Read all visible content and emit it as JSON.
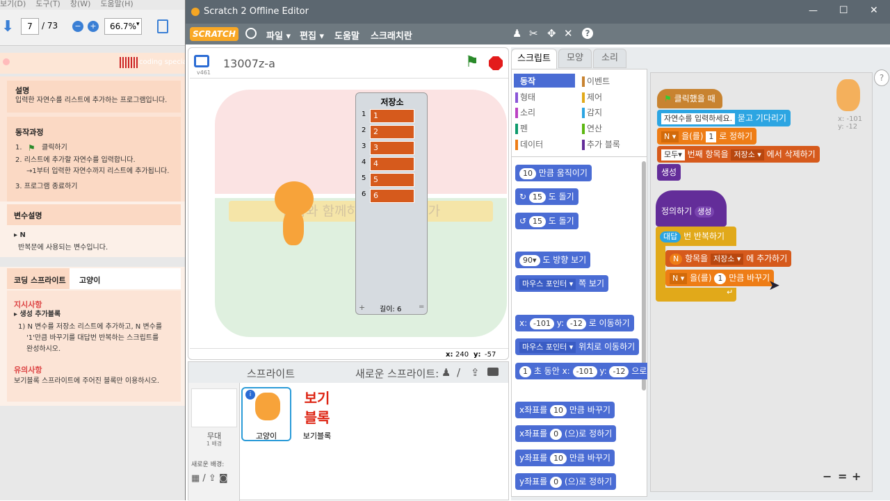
{
  "pdf": {
    "menus": [
      "보기(D)",
      "도구(T)",
      "창(W)",
      "도움말(H)"
    ],
    "page_current": "7",
    "page_total": "/ 73",
    "zoom": "66.7%",
    "sections": {
      "desc_title": "설명",
      "desc_text": "입력한 자연수를 리스트에 추가하는 프로그램입니다.",
      "proc_title": "동작과정",
      "proc_1a": "1.",
      "proc_1b": "클릭하기",
      "proc_2": "2.  리스트에 추가할 자연수를 입력합니다.",
      "proc_2b": "→1부터 입력한 자연수까지 리스트에 추가됩니다.",
      "proc_3": "3.  프로그램 종료하기",
      "var_title": "변수설명",
      "var_name": "▸ N",
      "var_text": "반복문에 사용되는 변수입니다.",
      "tab_a": "코딩 스프라이트",
      "tab_b": "고양이",
      "inst_title": "지시사항",
      "inst_sub": "▸ 생성 추가블록",
      "inst_text1": "1) N 변수를 저장소 리스트에 추가하고, N 변수를",
      "inst_text2": "'1'만큼 바꾸기를 대답번 반복하는 스크립트를",
      "inst_text3": "완성하시오.",
      "note_title": "유의사항",
      "note_text": "보기블록 스프라이트에 주어진 블록만 이용하시오.",
      "logo_text": "coding special"
    }
  },
  "window": {
    "title": "Scratch 2 Offline Editor",
    "min": "—",
    "max": "☐",
    "close": "✕"
  },
  "menubar": {
    "logo": "SCRATCH",
    "items": [
      "파일 ▾",
      "편집 ▾",
      "도움말",
      "스크래치란"
    ]
  },
  "stage": {
    "project": "13007z-a",
    "version": "v461",
    "coords_x_label": "x:",
    "coords_x": "240",
    "coords_y_label": "y:",
    "coords_y": "-57",
    "list": {
      "title": "저장소",
      "items": [
        "1",
        "2",
        "3",
        "4",
        "5",
        "6"
      ],
      "length": "길이: 6",
      "plus": "+",
      "resize": "="
    },
    "watermark": "엄마와 함께하는 코딩 전문가"
  },
  "sprites": {
    "header": "스프라이트",
    "new_label": "새로운 스프라이트:",
    "stage_name": "무대",
    "stage_count": "1 배경",
    "new_bg": "새로운 배경:",
    "cat_name": "고양이",
    "view_name": "보기블록",
    "view_text1": "보기",
    "view_text2": "블록"
  },
  "tabs": [
    "스크립트",
    "모양",
    "소리"
  ],
  "categories": {
    "left": [
      "동작",
      "형태",
      "소리",
      "펜",
      "데이터"
    ],
    "right": [
      "이벤트",
      "제어",
      "감지",
      "연산",
      "추가 블록"
    ]
  },
  "palette": {
    "move": [
      "10",
      "만큼 움직이기"
    ],
    "turn_r": [
      "15",
      "도 돌기"
    ],
    "turn_l": [
      "15",
      "도 돌기"
    ],
    "point": [
      "90▾",
      "도 방향 보기"
    ],
    "pointto": [
      "마우스 포인터 ▾",
      "쪽 보기"
    ],
    "goto": [
      "x:",
      "-101",
      "y:",
      "-12",
      "로 이동하기"
    ],
    "gotoobj": [
      "마우스 포인터 ▾",
      "위치로 이동하기"
    ],
    "glide": [
      "1",
      "초 동안 x:",
      "-101",
      "y:",
      "-12",
      "으로"
    ],
    "chx": [
      "x좌표를",
      "10",
      "만큼 바꾸기"
    ],
    "setx": [
      "x좌표를",
      "0",
      "(으)로 정하기"
    ],
    "chy": [
      "y좌표를",
      "10",
      "만큼 바꾸기"
    ],
    "sety": [
      "y좌표를",
      "0",
      "(으)로 정하기"
    ]
  },
  "script": {
    "hat": "클릭했을 때",
    "ask": [
      "자연수를 입력하세요.",
      "묻고 기다리기"
    ],
    "setn": [
      "N ▾",
      "을(를)",
      "1",
      "로 정하기"
    ],
    "del": [
      "모두▾",
      "번째 항목을",
      "저장소 ▾",
      "에서 삭제하기"
    ],
    "gen": "생성",
    "define": "정의하기",
    "define_arg": "생성",
    "repeat": [
      "대답",
      "번 반복하기"
    ],
    "add": [
      "N",
      "항목을",
      "저장소 ▾",
      "에 추가하기"
    ],
    "change": [
      "N ▾",
      "을(를)",
      "1",
      "만큼 바꾸기"
    ],
    "coords": "x: -101\ny: -12"
  },
  "zoom": {
    "minus": "−",
    "eq": "=",
    "plus": "+"
  },
  "colors": {
    "motion": "#4a6cd4",
    "looks": "#8a55d7",
    "sound": "#bb42c3",
    "pen": "#0e9a6c",
    "data": "#ee7d16",
    "events": "#c88330",
    "control": "#e1a91a",
    "sensing": "#2ca5e2",
    "operators": "#5cb712",
    "more": "#632d99",
    "list_item": "#d65a1c"
  }
}
